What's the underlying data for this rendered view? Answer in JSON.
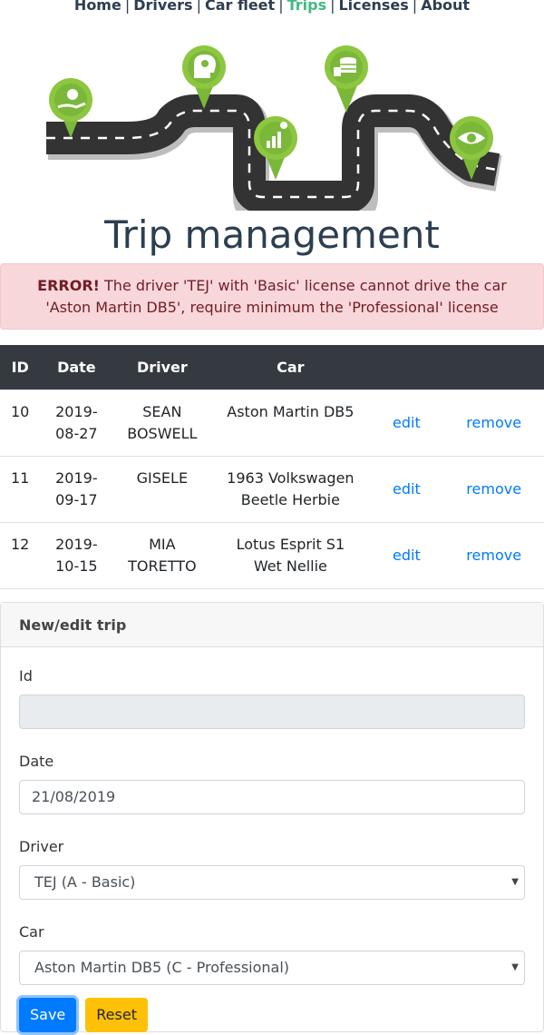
{
  "nav": {
    "items": [
      {
        "label": "Home"
      },
      {
        "label": "Drivers"
      },
      {
        "label": "Car fleet"
      },
      {
        "label": "Trips"
      },
      {
        "label": "Licenses"
      },
      {
        "label": "About"
      }
    ],
    "separator": "|",
    "active": "Trips"
  },
  "page": {
    "title": "Trip management"
  },
  "alert": {
    "label": "ERROR!",
    "message": " The driver 'TEJ' with 'Basic' license cannot drive the car 'Aston Martin DB5', require minimum the 'Professional' license"
  },
  "table": {
    "headers": [
      "ID",
      "Date",
      "Driver",
      "Car",
      "",
      ""
    ],
    "rows": [
      {
        "id": "10",
        "date": "2019-08-27",
        "driver": "SEAN BOSWELL",
        "car": "Aston Martin DB5",
        "edit": "edit",
        "remove": "remove"
      },
      {
        "id": "11",
        "date": "2019-09-17",
        "driver": "GISELE",
        "car": "1963 Volkswagen Beetle Herbie",
        "edit": "edit",
        "remove": "remove"
      },
      {
        "id": "12",
        "date": "2019-10-15",
        "driver": "MIA TORETTO",
        "car": "Lotus Esprit S1 Wet Nellie",
        "edit": "edit",
        "remove": "remove"
      }
    ]
  },
  "form": {
    "title": "New/edit trip",
    "id_label": "Id",
    "id_value": "",
    "date_label": "Date",
    "date_value": "21/08/2019",
    "driver_label": "Driver",
    "driver_value": "TEJ (A - Basic)",
    "car_label": "Car",
    "car_value": "Aston Martin DB5 (C - Professional)",
    "save_label": "Save",
    "reset_label": "Reset"
  },
  "colors": {
    "nav_text": "#2c3e50",
    "nav_active": "#42b983",
    "link": "#007bff",
    "alert_bg": "#f8d7da",
    "alert_text": "#721c24",
    "table_header_bg": "#343a40",
    "save_button": "#007bff",
    "reset_button": "#ffc107",
    "pin_green": "#8dc63f"
  }
}
